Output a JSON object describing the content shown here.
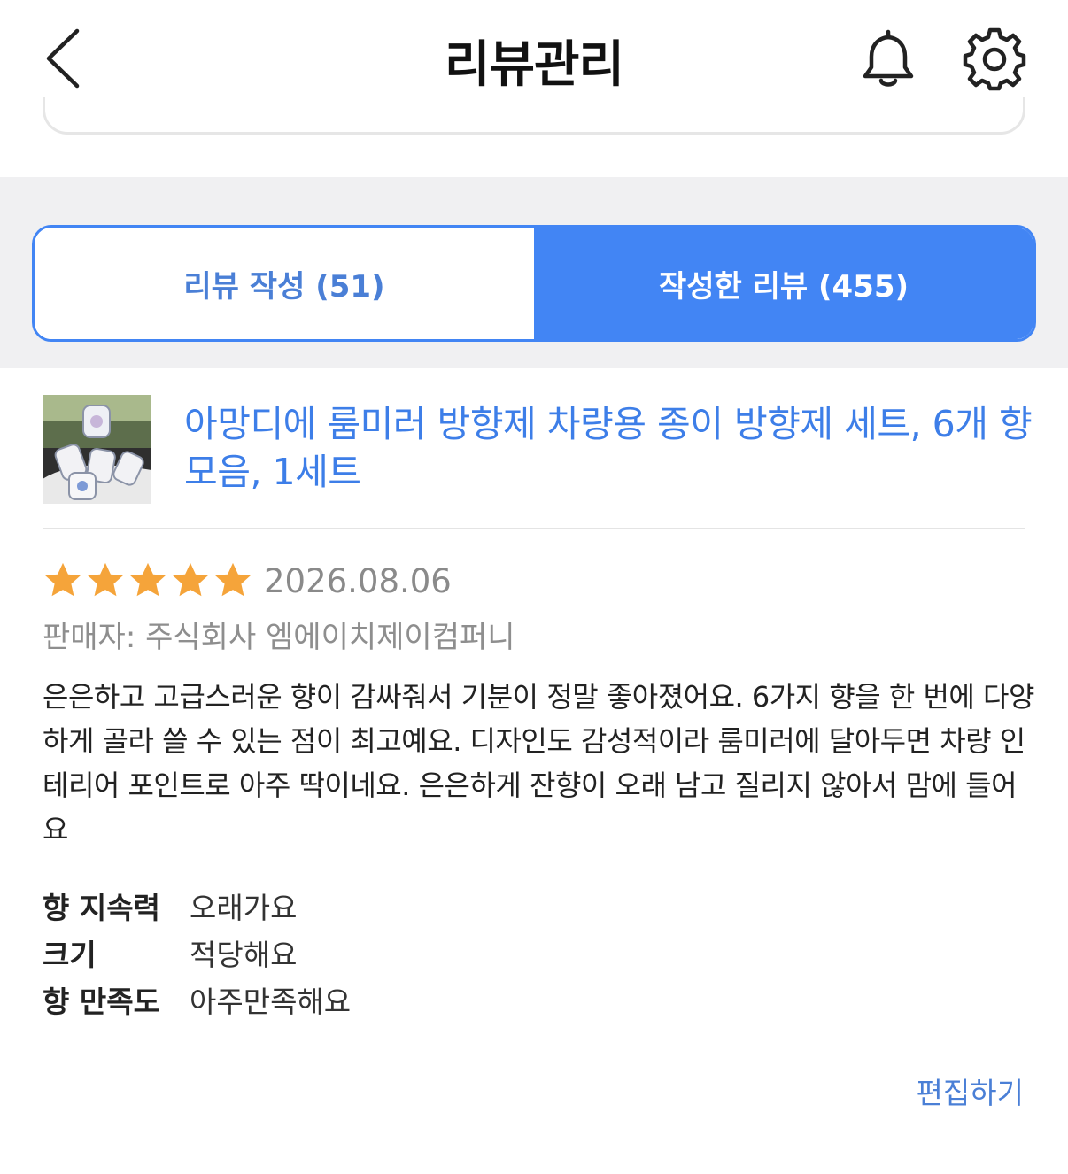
{
  "header": {
    "title": "리뷰관리",
    "icons": {
      "back": "chevron-left-icon",
      "bell": "bell-icon",
      "settings": "gear-icon"
    }
  },
  "tabs": [
    {
      "label": "리뷰 작성 (51)",
      "active": false
    },
    {
      "label": "작성한 리뷰 (455)",
      "active": true
    }
  ],
  "colors": {
    "accent": "#4285f4",
    "link": "#3d7ee8",
    "star": "#f5a43a",
    "tab_band": "#f0f0f2",
    "muted_text": "#8e8e8e"
  },
  "review": {
    "product_name": "아망디에 룸미러 방향제 차량용 종이 방향제 세트, 6개 향 모음, 1세트",
    "rating": 5,
    "max_rating": 5,
    "date": "2026.08.06",
    "seller": "판매자: 주식회사 엠에이치제이컴퍼니",
    "body": "은은하고 고급스러운 향이 감싸줘서 기분이 정말 좋아졌어요. 6가지 향을 한 번에 다양하게 골라 쓸 수 있는 점이 최고예요. 디자인도 감성적이라 룸미러에 달아두면 차량 인테리어 포인트로 아주 딱이네요. 은은하게 잔향이 오래 남고 질리지 않아서 맘에 들어요",
    "attributes": [
      {
        "label": "향 지속력",
        "value": "오래가요"
      },
      {
        "label": "크기",
        "value": "적당해요"
      },
      {
        "label": "향 만족도",
        "value": "아주만족해요"
      }
    ],
    "edit_label": "편집하기"
  }
}
